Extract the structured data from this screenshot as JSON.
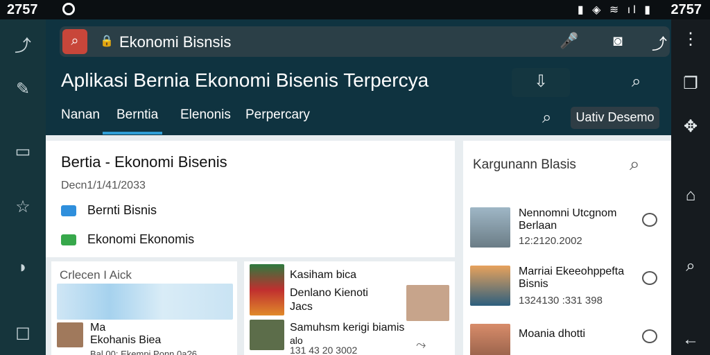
{
  "status_bar": {
    "time_left": "2757",
    "time_right": "2757",
    "icons": "▮ ◈ ≋ ıl ▮"
  },
  "url_bar": {
    "text": "Ekonomi Bisnsis"
  },
  "header": {
    "title": "Aplikasi Bernia Ekonomi Bisenis Terpercya",
    "tabs": [
      "Nanan",
      "Berntia",
      "Elenonis",
      "Perpercary"
    ],
    "login_label": "Uativ Desemo"
  },
  "article": {
    "title": "Bertia - Ekonomi Bisenis",
    "date": "Decn1/1/41/2033",
    "rows": [
      "Bernti Bisnis",
      "Ekonomi Ekonomis"
    ]
  },
  "cards": {
    "left_label": "Crlecen I Aick",
    "left_caption_1": "Ma",
    "left_caption_2": "Ekohanis Biea",
    "left_caption_3": "Bal 00: Ekempi Ponn 0a?6",
    "middle_title": "Kasiham bica",
    "middle_subtitle": "Denlano Kienoti",
    "middle_tag": "Jacs",
    "middle_bottom": "Samuhsm kerigi biamis",
    "middle_bottom_sub": "alo",
    "middle_bottom_date": "131 43 20 3002"
  },
  "sidebar": {
    "title": "Kargunann Blasis",
    "items": [
      {
        "title": "Nennomni Utcgnom Berlaan",
        "date": "12:2120.2002"
      },
      {
        "title": "Marriai Ekeeohppefta Bisnis",
        "date": "1324130 :331 398"
      },
      {
        "title": "Moania dhotti",
        "date": ""
      }
    ]
  },
  "colors": {
    "accent": "#2f9ed6",
    "search_button": "#c8463a",
    "header_bg": "#0f3340"
  }
}
